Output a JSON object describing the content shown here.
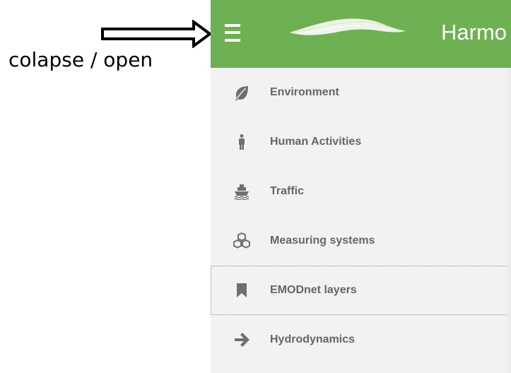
{
  "annotation": {
    "text": "colapse / open"
  },
  "header": {
    "title": "Harmo",
    "background": "#6db152"
  },
  "menu": {
    "items": [
      {
        "label": "Environment",
        "icon": "leaf-icon"
      },
      {
        "label": "Human Activities",
        "icon": "person-icon"
      },
      {
        "label": "Traffic",
        "icon": "ship-icon"
      },
      {
        "label": "Measuring systems",
        "icon": "cubes-icon"
      },
      {
        "label": "EMODnet layers",
        "icon": "bookmark-icon",
        "active": true
      },
      {
        "label": "Hydrodynamics",
        "icon": "arrow-right-icon"
      }
    ]
  },
  "colors": {
    "menu_text": "#666666",
    "menu_icon": "#6f6f6f",
    "panel_bg": "#f2f2f2"
  }
}
